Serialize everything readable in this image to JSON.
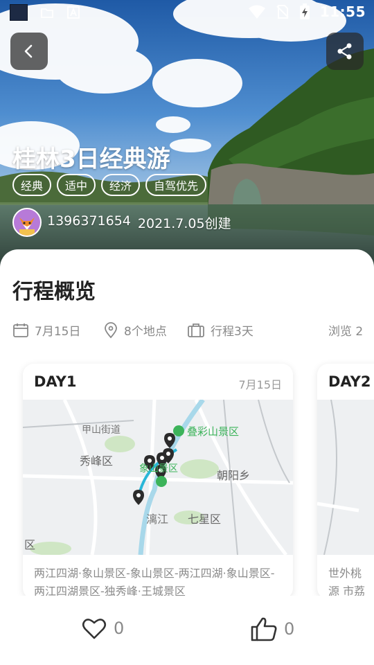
{
  "status_bar": {
    "time": "11:55"
  },
  "trip": {
    "title": "桂林3日经典游",
    "tags": [
      "经典",
      "适中",
      "经济",
      "自驾优先"
    ],
    "author": "1396371654",
    "created": "2021.7.05创建"
  },
  "overview": {
    "title": "行程概览",
    "date": "7月15日",
    "places": "8个地点",
    "duration": "行程3天",
    "views": "浏览 2"
  },
  "days": [
    {
      "day": "DAY1",
      "date": "7月15日",
      "map_labels": [
        "甲山街道",
        "叠彩山景区",
        "秀峰区",
        "象山景区",
        "朝阳乡",
        "漓江",
        "七星区",
        "区"
      ],
      "route": "两江四湖·象山景区-象山景区-两江四湖·象山景区-两江四湖景区-独秀峰·王城景区"
    },
    {
      "day": "DAY2",
      "date": "",
      "route": "世外桃源 市荔浦"
    }
  ],
  "actions": {
    "favorite_count": "0",
    "like_count": "0"
  },
  "colors": {
    "accent_route": "#2ab7d8",
    "scenic_green": "#3cb35a"
  },
  "icons": [
    "back-icon",
    "share-icon",
    "calendar-icon",
    "location-pin-icon",
    "suitcase-icon",
    "heart-icon",
    "thumbs-up-icon",
    "map-marker-icon"
  ]
}
